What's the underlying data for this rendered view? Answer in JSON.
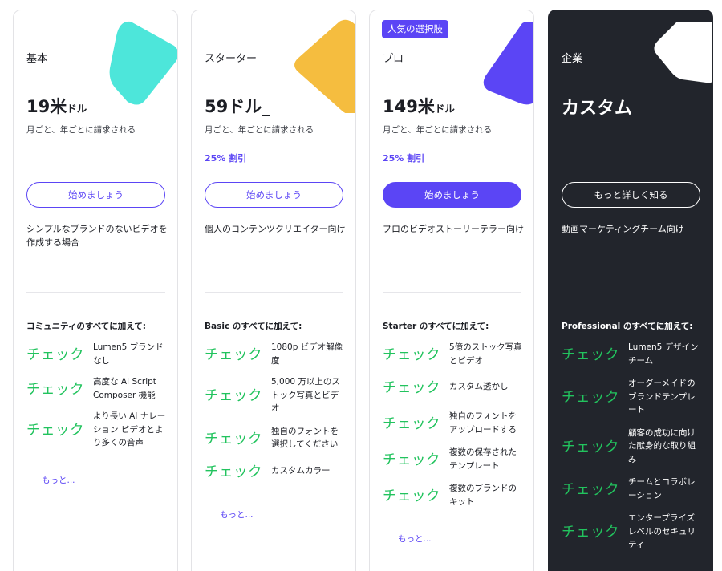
{
  "plans": [
    {
      "name": "基本",
      "price_main": "19米",
      "price_unit": "ドル",
      "billing": "月ごと、年ごとに請求される",
      "discount": "",
      "cta": "始めましょう",
      "description": "シンプルなブランドのないビデオを作成する場合",
      "features_heading": "コミュニティのすべてに加えて:",
      "features": [
        "Lumen5 ブランドなし",
        "高度な AI Script Composer 機能",
        "より長い AI ナレーション ビデオとより多くの音声"
      ],
      "more": "もっと..."
    },
    {
      "name": "スターター",
      "price_main": "59ドル_",
      "price_unit": "",
      "billing": "月ごと、年ごとに請求される",
      "discount": "25% 割引",
      "cta": "始めましょう",
      "description": "個人のコンテンツクリエイター向け",
      "features_heading": "Basic のすべてに加えて:",
      "features": [
        "1080p ビデオ解像度",
        "5,000 万以上のストック写真とビデオ",
        "独自のフォントを選択してください",
        "カスタムカラー"
      ],
      "more": "もっと..."
    },
    {
      "name": "プロ",
      "badge": "人気の選択肢",
      "price_main": "149米",
      "price_unit": "ドル",
      "billing": "月ごと、年ごとに請求される",
      "discount": "25% 割引",
      "cta": "始めましょう",
      "description": "プロのビデオストーリーテラー向け",
      "features_heading": "Starter のすべてに加えて:",
      "features": [
        "5億のストック写真とビデオ",
        "カスタム透かし",
        "独自のフォントをアップロードする",
        "複数の保存されたテンプレート",
        "複数のブランドのキット"
      ],
      "more": "もっと..."
    },
    {
      "name": "企業",
      "price_main": "カスタム",
      "price_unit": "",
      "billing": "",
      "discount": "",
      "cta": "もっと詳しく知る",
      "description": "動画マーケティングチーム向け",
      "features_heading": "Professional のすべてに加えて:",
      "features": [
        "Lumen5 デザインチーム",
        "オーダーメイドのブランドテンプレート",
        "顧客の成功に向けた献身的な取り組み",
        "チームとコラボレーション",
        "エンタープライズレベルのセキュリティ"
      ],
      "more": ""
    }
  ],
  "check_label": "チェック",
  "colors": {
    "accent": "#5b45f5",
    "check_green": "#22c35e",
    "dark_card": "#22252c",
    "blob_basic": "#4de6da",
    "blob_starter": "#f5bd3f",
    "blob_pro": "#5b45f5",
    "blob_enterprise": "#ffffff"
  }
}
